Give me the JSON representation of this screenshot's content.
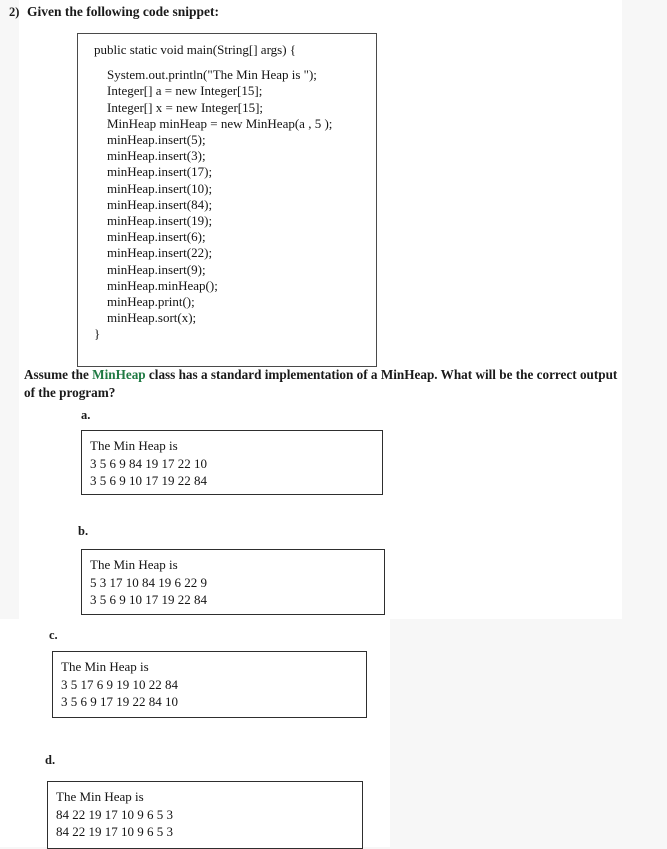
{
  "question": {
    "number": "2)",
    "prompt": "Given the following code snippet:"
  },
  "code_snippet": {
    "lines": [
      "public static void main(String[] args) {",
      "",
      "    System.out.println(\"The Min Heap is \");",
      "    Integer[] a = new Integer[15];",
      "    Integer[] x = new Integer[15];",
      "    MinHeap minHeap = new MinHeap(a , 5 );",
      "    minHeap.insert(5);",
      "    minHeap.insert(3);",
      "    minHeap.insert(17);",
      "    minHeap.insert(10);",
      "    minHeap.insert(84);",
      "    minHeap.insert(19);",
      "    minHeap.insert(6);",
      "    minHeap.insert(22);",
      "    minHeap.insert(9);",
      "    minHeap.minHeap();",
      "    minHeap.print();",
      "    minHeap.sort(x);",
      "}"
    ]
  },
  "assume_text": {
    "before": "Assume the ",
    "highlight": "MinHeap",
    "after": " class has a standard implementation of a MinHeap. What will be the correct output of the program?",
    "highlight_color": "#1f7a43"
  },
  "options": [
    {
      "label": "a.",
      "lines": [
        "The Min Heap is",
        "3 5 6 9 84 19 17 22 10",
        "3 5 6 9 10 17 19 22 84"
      ]
    },
    {
      "label": "b.",
      "lines": [
        "The Min Heap is",
        "5 3 17 10 84 19 6 22 9",
        "3 5 6 9 10 17 19 22 84"
      ]
    },
    {
      "label": "c.",
      "lines": [
        "The Min Heap is",
        "3 5 17 6 9 19 10 22 84",
        "3 5 6 9 17 19 22 84 10"
      ]
    },
    {
      "label": "d.",
      "lines": [
        "The Min Heap is",
        "84 22 19 17 10 9 6 5 3",
        "84 22 19 17 10 9 6 5 3"
      ]
    }
  ]
}
